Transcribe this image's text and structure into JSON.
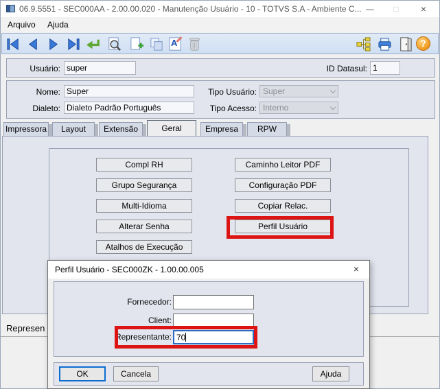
{
  "window": {
    "title": "06.9.5551 - SEC000AA - 2.00.00.020 - Manutenção Usuário - 10 - TOTVS S.A - Ambiente C...",
    "controls": {
      "minimize": "—",
      "maximize": "□",
      "close": "×"
    },
    "menu": {
      "arquivo": "Arquivo",
      "ajuda": "Ajuda"
    }
  },
  "toolbar": {
    "left_icons": [
      "first-record",
      "previous-record",
      "next-record",
      "last-record",
      "enter-confirm",
      "search-view",
      "new-record",
      "copy-record",
      "edit-record",
      "delete-record"
    ],
    "right_icons": [
      "hierarchy-tree",
      "print",
      "exit",
      "help"
    ],
    "edit_glyph": "A",
    "help_glyph": "?"
  },
  "form": {
    "usuario": {
      "label": "Usuário:",
      "value": "super"
    },
    "id_datasul": {
      "label": "ID Datasul:",
      "value": "1"
    },
    "nome": {
      "label": "Nome:",
      "value": "Super"
    },
    "dialeto": {
      "label": "Dialeto:",
      "value": "Dialeto Padrão Português"
    },
    "tipo_usuario": {
      "label": "Tipo Usuário:",
      "value": "Super"
    },
    "tipo_acesso": {
      "label": "Tipo Acesso:",
      "value": "Interno"
    }
  },
  "tabs": [
    "Impressora",
    "Layout",
    "Extensão",
    "Geral",
    "Empresa",
    "RPW"
  ],
  "active_tab": "Geral",
  "geral_buttons": {
    "left": [
      "Compl RH",
      "Grupo Segurança",
      "Multi-Idioma",
      "Alterar Senha",
      "Atalhos de Execução"
    ],
    "right": [
      "Caminho Leitor PDF",
      "Configuração PDF",
      "Copiar Relac.",
      "Perfil Usuário"
    ]
  },
  "status": {
    "text": "Represen"
  },
  "dialog": {
    "title": "Perfil Usuário - SEC000ZK - 1.00.00.005",
    "close": "×",
    "fields": {
      "fornecedor": {
        "label": "Fornecedor:",
        "value": ""
      },
      "client": {
        "label": "Client:",
        "value": ""
      },
      "representante": {
        "label": "Representante:",
        "value": "70"
      }
    },
    "buttons": {
      "ok": "OK",
      "cancel": "Cancela",
      "help": "Ajuda"
    }
  },
  "colors": {
    "annotation_red": "#dd1414",
    "focus_blue": "#0b6cd0"
  }
}
